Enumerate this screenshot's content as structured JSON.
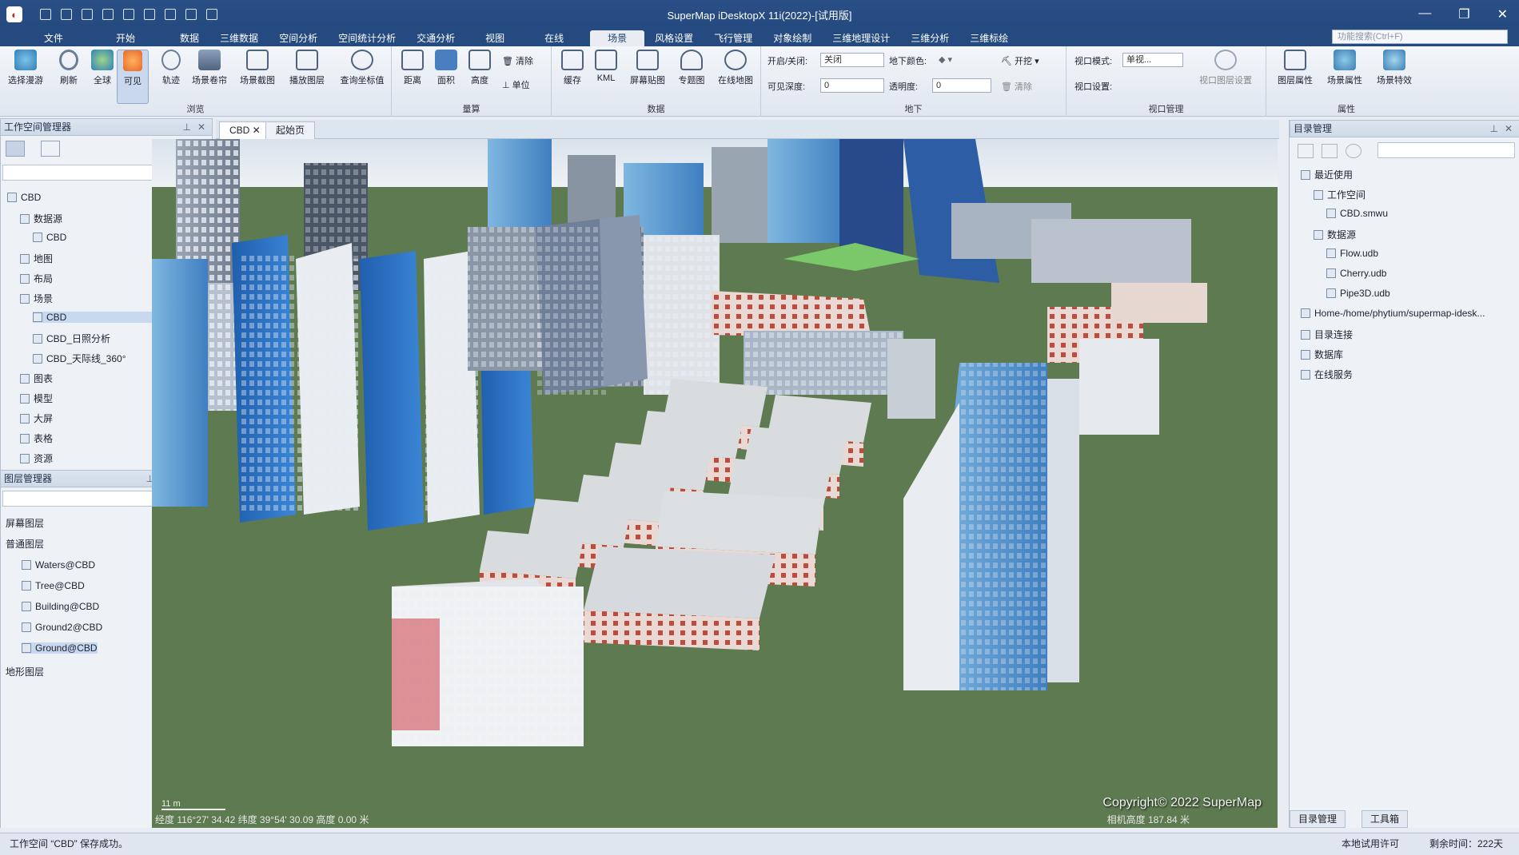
{
  "app": {
    "title": "SuperMap iDesktopX 11i(2022)-[试用版]",
    "window_controls": [
      "—",
      "❐",
      "✕"
    ]
  },
  "menu": {
    "tabs": [
      "文件",
      "开始",
      "数据",
      "三维数据",
      "空间分析",
      "空间统计分析",
      "交通分析",
      "视图",
      "在线",
      "场景",
      "风格设置",
      "飞行管理",
      "对象绘制",
      "三维地理设计",
      "三维分析",
      "三维标绘"
    ],
    "active_tab": "场景",
    "search_placeholder": "功能搜索(Ctrl+F)"
  },
  "ribbon": {
    "browse": {
      "label": "浏览",
      "buttons": [
        "选择漫游",
        "刷新",
        "全球",
        "可见",
        "轨迹",
        "场景卷帘",
        "场景截图",
        "播放图层",
        "查询坐标值"
      ]
    },
    "measure": {
      "label": "量算",
      "buttons": [
        "距离",
        "面积",
        "高度"
      ],
      "small": [
        "清除",
        "单位"
      ]
    },
    "data": {
      "label": "数据",
      "buttons": [
        "缓存",
        "KML",
        "屏幕贴图",
        "专题图",
        "在线地图"
      ]
    },
    "underground": {
      "label": "地下",
      "toggle_label": "开启/关闭:",
      "toggle_value": "关闭",
      "visible_depth_label": "可见深度:",
      "visible_depth_value": "0",
      "color_label": "地下颜色:",
      "transparency_label": "透明度:",
      "transparency_value": "0",
      "dig_label": "开挖",
      "clear_label": "清除"
    },
    "viewport": {
      "label": "视口管理",
      "mode_label": "视口模式:",
      "mode_value": "单视...",
      "settings_label": "视口设置:",
      "layer_settings": "视口图层设置"
    },
    "properties": {
      "label": "属性",
      "buttons": [
        "图层属性",
        "场景属性",
        "场景特效"
      ]
    }
  },
  "workspace_panel": {
    "title": "工作空间管理器",
    "items": [
      {
        "label": "CBD",
        "indent": 0
      },
      {
        "label": "数据源",
        "indent": 1
      },
      {
        "label": "CBD",
        "indent": 2
      },
      {
        "label": "地图",
        "indent": 1
      },
      {
        "label": "布局",
        "indent": 1
      },
      {
        "label": "场景",
        "indent": 1
      },
      {
        "label": "CBD",
        "indent": 2,
        "selected": true
      },
      {
        "label": "CBD_日照分析",
        "indent": 2
      },
      {
        "label": "CBD_天际线_360°",
        "indent": 2
      },
      {
        "label": "图表",
        "indent": 1
      },
      {
        "label": "模型",
        "indent": 1
      },
      {
        "label": "大屏",
        "indent": 1
      },
      {
        "label": "表格",
        "indent": 1
      },
      {
        "label": "资源",
        "indent": 1
      }
    ]
  },
  "layer_panel": {
    "title": "图层管理器",
    "groups": [
      "屏幕图层",
      "普通图层"
    ],
    "layers": [
      "Waters@CBD",
      "Tree@CBD",
      "Building@CBD",
      "Ground2@CBD",
      "Ground@CBD"
    ],
    "footer": "地形图层"
  },
  "doc_tabs": [
    "CBD",
    "起始页"
  ],
  "viewport": {
    "copyright": "Copyright© 2022 SuperMap",
    "status": "经度 116°27'  34.42  纬度 39°54'  30.09  高度 0.00 米",
    "altitude": "相机高度 187.84 米",
    "scale": "11 m"
  },
  "catalog_panel": {
    "title": "目录管理",
    "items": [
      {
        "label": "最近使用",
        "indent": 0
      },
      {
        "label": "工作空间",
        "indent": 1
      },
      {
        "label": "CBD.smwu",
        "indent": 2
      },
      {
        "label": "数据源",
        "indent": 1
      },
      {
        "label": "Flow.udb",
        "indent": 2
      },
      {
        "label": "Cherry.udb",
        "indent": 2
      },
      {
        "label": "Pipe3D.udb",
        "indent": 2
      },
      {
        "label": "Home-/home/phytium/supermap-idesk...",
        "indent": 0
      },
      {
        "label": "目录连接",
        "indent": 0
      },
      {
        "label": "数据库",
        "indent": 0
      },
      {
        "label": "在线服务",
        "indent": 0
      }
    ],
    "bottom_tabs": [
      "目录管理",
      "工具箱"
    ]
  },
  "statusbar": {
    "left": "工作空间 “CBD” 保存成功。",
    "right1": "本地试用许可",
    "right2": "剩余时间：222天"
  }
}
